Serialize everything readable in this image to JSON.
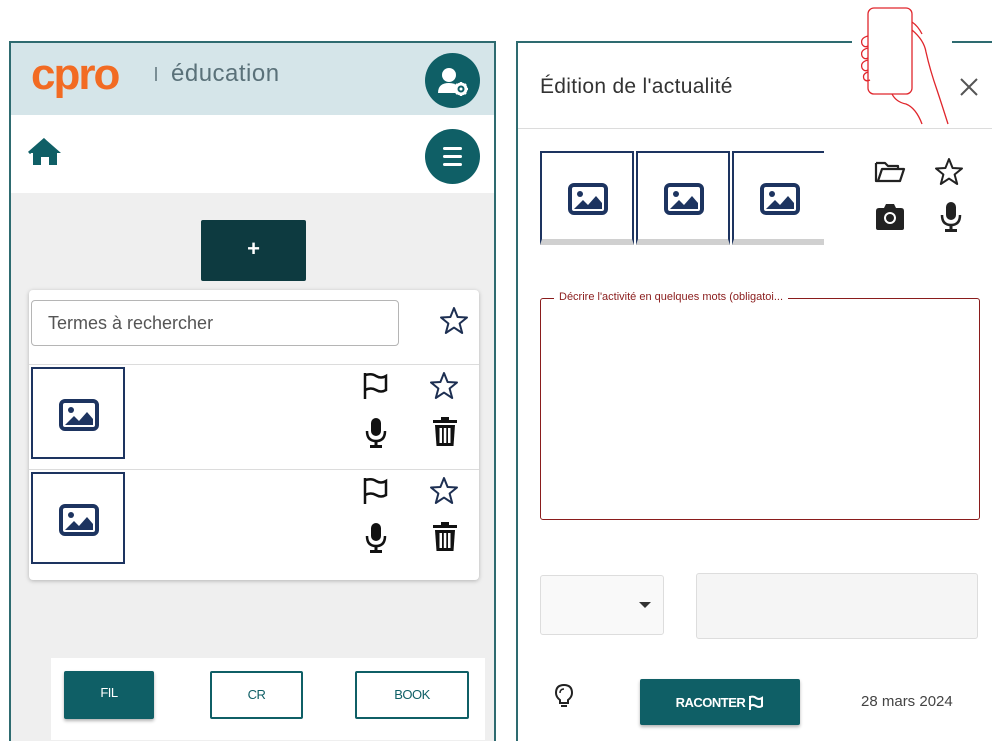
{
  "brand": {
    "logo": "cpro",
    "subtitle": "éducation",
    "logo_color": "#f26b23",
    "accent": "#0f5f66"
  },
  "left": {
    "add_label": "+",
    "search": {
      "placeholder": "Termes à rechercher"
    },
    "rows": [
      {
        "image": "image-placeholder"
      },
      {
        "image": "image-placeholder"
      }
    ],
    "tabs": [
      {
        "label": "FIL",
        "active": true
      },
      {
        "label": "CR",
        "active": false
      },
      {
        "label": "BOOK",
        "active": false
      }
    ]
  },
  "right": {
    "title": "Édition de l'actualité",
    "description_label": "Décrire l'activité en quelques mots (obligatoi...",
    "raconter_label": "RACONTER",
    "date": "28 mars 2024",
    "media_count": 3
  },
  "icons": {
    "user_settings": "user-gear-icon",
    "home": "home-icon",
    "menu": "hamburger-menu-icon",
    "star": "star-outline-icon",
    "flag": "flag-outline-icon",
    "mic": "microphone-icon",
    "trash": "trash-icon",
    "folder": "folder-open-icon",
    "camera": "camera-icon",
    "bulb": "lightbulb-icon",
    "close": "close-icon",
    "phone": "phone-in-hand-icon"
  }
}
